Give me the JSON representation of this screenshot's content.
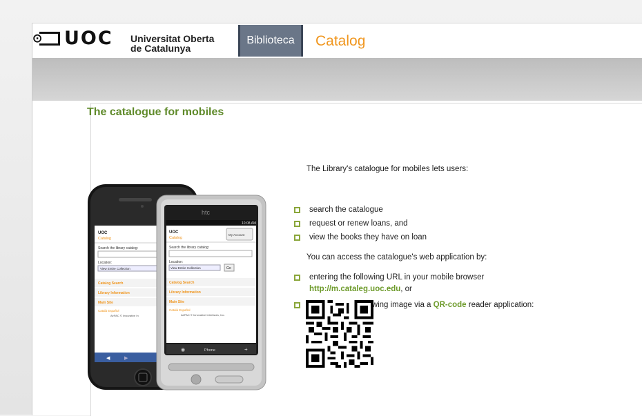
{
  "header": {
    "logo_text": "UOC",
    "university_line1": "Universitat Oberta",
    "university_line2": "de Catalunya",
    "section_tab": "Biblioteca",
    "page_heading": "Catalog"
  },
  "content": {
    "title": "The catalogue for mobiles",
    "intro": "The Library's catalogue for mobiles lets users:",
    "features": [
      "search the catalogue",
      "request or renew loans, and",
      "view the books they have on loan"
    ],
    "access_intro": "You can access the catalogue's web application by:",
    "option1_text": "entering the following URL in your mobile browser",
    "option1_url": "http://m.cataleg.uoc.edu",
    "option1_suffix": ", or",
    "option2_prefix": "capturing the following image via a ",
    "option2_link": "QR-code",
    "option2_suffix": " reader application:"
  },
  "phones": {
    "iphone": {
      "logo": "UOC",
      "catalog": "Catalog",
      "search_label": "Search the library catalog:",
      "location_label": "Location:",
      "location_value": "View Entire Collection",
      "items": [
        "Catalog Search",
        "Library Information",
        "Main Site"
      ],
      "footer_links": "Català Español",
      "footer_note": "AirPAC © Innovative In"
    },
    "htc": {
      "brand": "htc",
      "time": "10:08 AM",
      "logo": "UOC",
      "catalog": "Catalog",
      "my_account": "My Account",
      "search_label": "Search the library catalog:",
      "location_label": "Location:",
      "location_value": "View Entire Collection",
      "go": "Go",
      "items": [
        "Catalog Search",
        "Library Information",
        "Main Site"
      ],
      "footer_links": "Català Español",
      "footer_note": "AirPAC © Innovative Interfaces, Inc.",
      "phone_label": "Phone"
    }
  },
  "colors": {
    "accent_orange": "#f0961e",
    "accent_green": "#6e9b2c",
    "tab_bg": "#6a7688"
  }
}
